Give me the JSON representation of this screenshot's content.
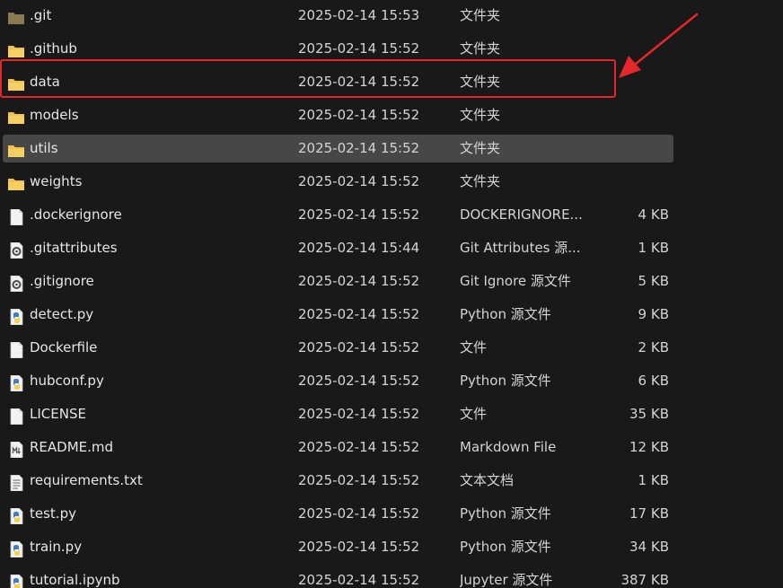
{
  "colors": {
    "folder": "#f0c24b",
    "folder_dark": "#8a7a52",
    "file": "#f2f2f2",
    "python_blue": "#3f7cc4",
    "python_yellow": "#f4d04b",
    "annotation": "#e5262b",
    "selected_row": "#474747"
  },
  "files": [
    {
      "name": ".git",
      "date": "2025-02-14 15:53",
      "type": "文件夹",
      "size": "",
      "icon": "folder-icon"
    },
    {
      "name": ".github",
      "date": "2025-02-14 15:52",
      "type": "文件夹",
      "size": "",
      "icon": "folder-icon"
    },
    {
      "name": "data",
      "date": "2025-02-14 15:52",
      "type": "文件夹",
      "size": "",
      "icon": "folder-icon"
    },
    {
      "name": "models",
      "date": "2025-02-14 15:52",
      "type": "文件夹",
      "size": "",
      "icon": "folder-icon"
    },
    {
      "name": "utils",
      "date": "2025-02-14 15:52",
      "type": "文件夹",
      "size": "",
      "icon": "folder-icon"
    },
    {
      "name": "weights",
      "date": "2025-02-14 15:52",
      "type": "文件夹",
      "size": "",
      "icon": "folder-icon"
    },
    {
      "name": ".dockerignore",
      "date": "2025-02-14 15:52",
      "type": "DOCKERIGNORE...",
      "size": "4 KB",
      "icon": "file-icon"
    },
    {
      "name": ".gitattributes",
      "date": "2025-02-14 15:44",
      "type": "Git Attributes 源...",
      "size": "1 KB",
      "icon": "gear-file-icon"
    },
    {
      "name": ".gitignore",
      "date": "2025-02-14 15:52",
      "type": "Git Ignore 源文件",
      "size": "5 KB",
      "icon": "gear-file-icon"
    },
    {
      "name": "detect.py",
      "date": "2025-02-14 15:52",
      "type": "Python 源文件",
      "size": "9 KB",
      "icon": "python-file-icon"
    },
    {
      "name": "Dockerfile",
      "date": "2025-02-14 15:52",
      "type": "文件",
      "size": "2 KB",
      "icon": "file-icon"
    },
    {
      "name": "hubconf.py",
      "date": "2025-02-14 15:52",
      "type": "Python 源文件",
      "size": "6 KB",
      "icon": "python-file-icon"
    },
    {
      "name": "LICENSE",
      "date": "2025-02-14 15:52",
      "type": "文件",
      "size": "35 KB",
      "icon": "file-icon"
    },
    {
      "name": "README.md",
      "date": "2025-02-14 15:52",
      "type": "Markdown File",
      "size": "12 KB",
      "icon": "markdown-file-icon"
    },
    {
      "name": "requirements.txt",
      "date": "2025-02-14 15:52",
      "type": "文本文档",
      "size": "1 KB",
      "icon": "text-file-icon"
    },
    {
      "name": "test.py",
      "date": "2025-02-14 15:52",
      "type": "Python 源文件",
      "size": "17 KB",
      "icon": "python-file-icon"
    },
    {
      "name": "train.py",
      "date": "2025-02-14 15:52",
      "type": "Python 源文件",
      "size": "34 KB",
      "icon": "python-file-icon"
    },
    {
      "name": "tutorial.ipynb",
      "date": "2025-02-14 15:52",
      "type": "Jupyter 源文件",
      "size": "387 KB",
      "icon": "python-file-icon"
    }
  ],
  "selected_index": 4,
  "highlighted_index": 2
}
